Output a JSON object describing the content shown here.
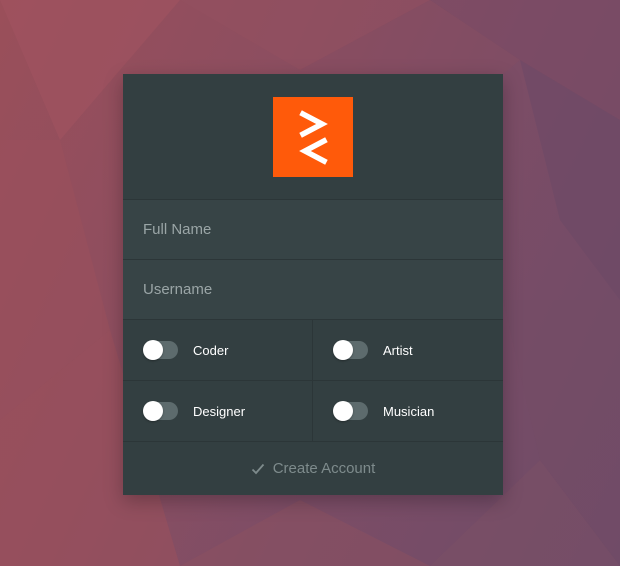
{
  "colors": {
    "background_start": "#9a4f5a",
    "background_end": "#6d4b68",
    "card": "#333f41",
    "field": "#374446",
    "accent": "#ff5a0a",
    "toggle_track": "#5d6b6d",
    "submit_text": "#7e8b8c"
  },
  "logo": {
    "icon": "double-chevron-logo-icon"
  },
  "form": {
    "full_name": {
      "placeholder": "Full Name",
      "value": ""
    },
    "username": {
      "placeholder": "Username",
      "value": ""
    },
    "roles": [
      {
        "label": "Coder",
        "checked": false
      },
      {
        "label": "Artist",
        "checked": false
      },
      {
        "label": "Designer",
        "checked": false
      },
      {
        "label": "Musician",
        "checked": false
      }
    ],
    "submit": {
      "label": "Create Account",
      "icon": "check-icon"
    }
  }
}
